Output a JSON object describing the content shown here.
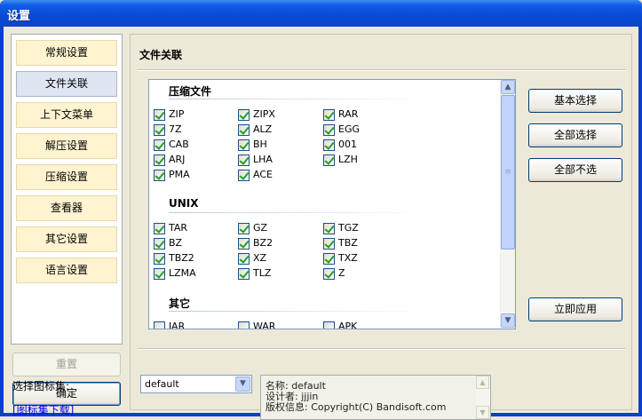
{
  "window": {
    "title": "设置"
  },
  "nav": {
    "items": [
      {
        "label": "常规设置",
        "active": false
      },
      {
        "label": "文件关联",
        "active": true
      },
      {
        "label": "上下文菜单",
        "active": false
      },
      {
        "label": "解压设置",
        "active": false
      },
      {
        "label": "压缩设置",
        "active": false
      },
      {
        "label": "查看器",
        "active": false
      },
      {
        "label": "其它设置",
        "active": false
      },
      {
        "label": "语言设置",
        "active": false
      }
    ],
    "reset_label": "重置",
    "ok_label": "确定"
  },
  "main": {
    "section_title": "文件关联",
    "groups": [
      {
        "title": "压缩文件",
        "items": [
          {
            "label": "ZIP",
            "checked": true
          },
          {
            "label": "ZIPX",
            "checked": true
          },
          {
            "label": "RAR",
            "checked": true
          },
          {
            "label": "7Z",
            "checked": true
          },
          {
            "label": "ALZ",
            "checked": true
          },
          {
            "label": "EGG",
            "checked": true
          },
          {
            "label": "CAB",
            "checked": true
          },
          {
            "label": "BH",
            "checked": true
          },
          {
            "label": "001",
            "checked": true
          },
          {
            "label": "ARJ",
            "checked": true
          },
          {
            "label": "LHA",
            "checked": true
          },
          {
            "label": "LZH",
            "checked": true
          },
          {
            "label": "PMA",
            "checked": true
          },
          {
            "label": "ACE",
            "checked": true
          }
        ]
      },
      {
        "title": "UNIX",
        "items": [
          {
            "label": "TAR",
            "checked": true
          },
          {
            "label": "GZ",
            "checked": true
          },
          {
            "label": "TGZ",
            "checked": true
          },
          {
            "label": "BZ",
            "checked": true
          },
          {
            "label": "BZ2",
            "checked": true
          },
          {
            "label": "TBZ",
            "checked": true
          },
          {
            "label": "TBZ2",
            "checked": true
          },
          {
            "label": "XZ",
            "checked": true
          },
          {
            "label": "TXZ",
            "checked": true
          },
          {
            "label": "LZMA",
            "checked": true
          },
          {
            "label": "TLZ",
            "checked": true
          },
          {
            "label": "Z",
            "checked": true
          }
        ]
      },
      {
        "title": "其它",
        "items": [
          {
            "label": "JAR",
            "checked": false
          },
          {
            "label": "WAR",
            "checked": false
          },
          {
            "label": "APK",
            "checked": false
          }
        ]
      }
    ],
    "buttons": {
      "basic_select": "基本选择",
      "select_all": "全部选择",
      "deselect_all": "全部不选",
      "apply_now": "立即应用"
    },
    "icon_set": {
      "label": "选择图标集:",
      "value": "default",
      "download_link": "[图标集下载]",
      "info": {
        "name": "名称: default",
        "designer": "设计者: jjjin",
        "copyright": "版权信息: Copyright(C) Bandisoft.com"
      }
    }
  },
  "colors": {
    "title_bar": "#0a4ad6",
    "nav_active": "#dfe6f2",
    "nav_inactive": "#fff3d0",
    "check": "#21a121"
  }
}
